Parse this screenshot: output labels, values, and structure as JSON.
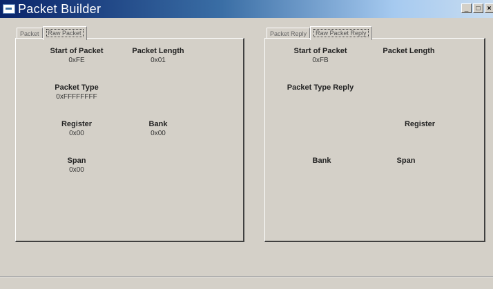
{
  "window": {
    "title": "Packet Builder",
    "controls": {
      "minimize": "_",
      "maximize": "□",
      "close": "×"
    }
  },
  "left_panel": {
    "tabs": [
      {
        "label": "Packet",
        "active": false
      },
      {
        "label": "Raw Packet",
        "active": true
      }
    ],
    "fields": {
      "start_of_packet": {
        "label": "Start of Packet",
        "value": "0xFE"
      },
      "packet_length": {
        "label": "Packet Length",
        "value": "0x01"
      },
      "packet_type": {
        "label": "Packet Type",
        "value": "0xFFFFFFFF"
      },
      "register": {
        "label": "Register",
        "value": "0x00"
      },
      "bank": {
        "label": "Bank",
        "value": "0x00"
      },
      "span": {
        "label": "Span",
        "value": "0x00"
      }
    }
  },
  "right_panel": {
    "tabs": [
      {
        "label": "Packet Reply",
        "active": false
      },
      {
        "label": "Raw Packet Reply",
        "active": true
      }
    ],
    "fields": {
      "start_of_packet": {
        "label": "Start of Packet",
        "value": "0xFB"
      },
      "packet_length": {
        "label": "Packet Length",
        "value": ""
      },
      "packet_type_reply": {
        "label": "Packet Type Reply",
        "value": ""
      },
      "register": {
        "label": "Register",
        "value": ""
      },
      "bank": {
        "label": "Bank",
        "value": ""
      },
      "span": {
        "label": "Span",
        "value": ""
      }
    }
  }
}
